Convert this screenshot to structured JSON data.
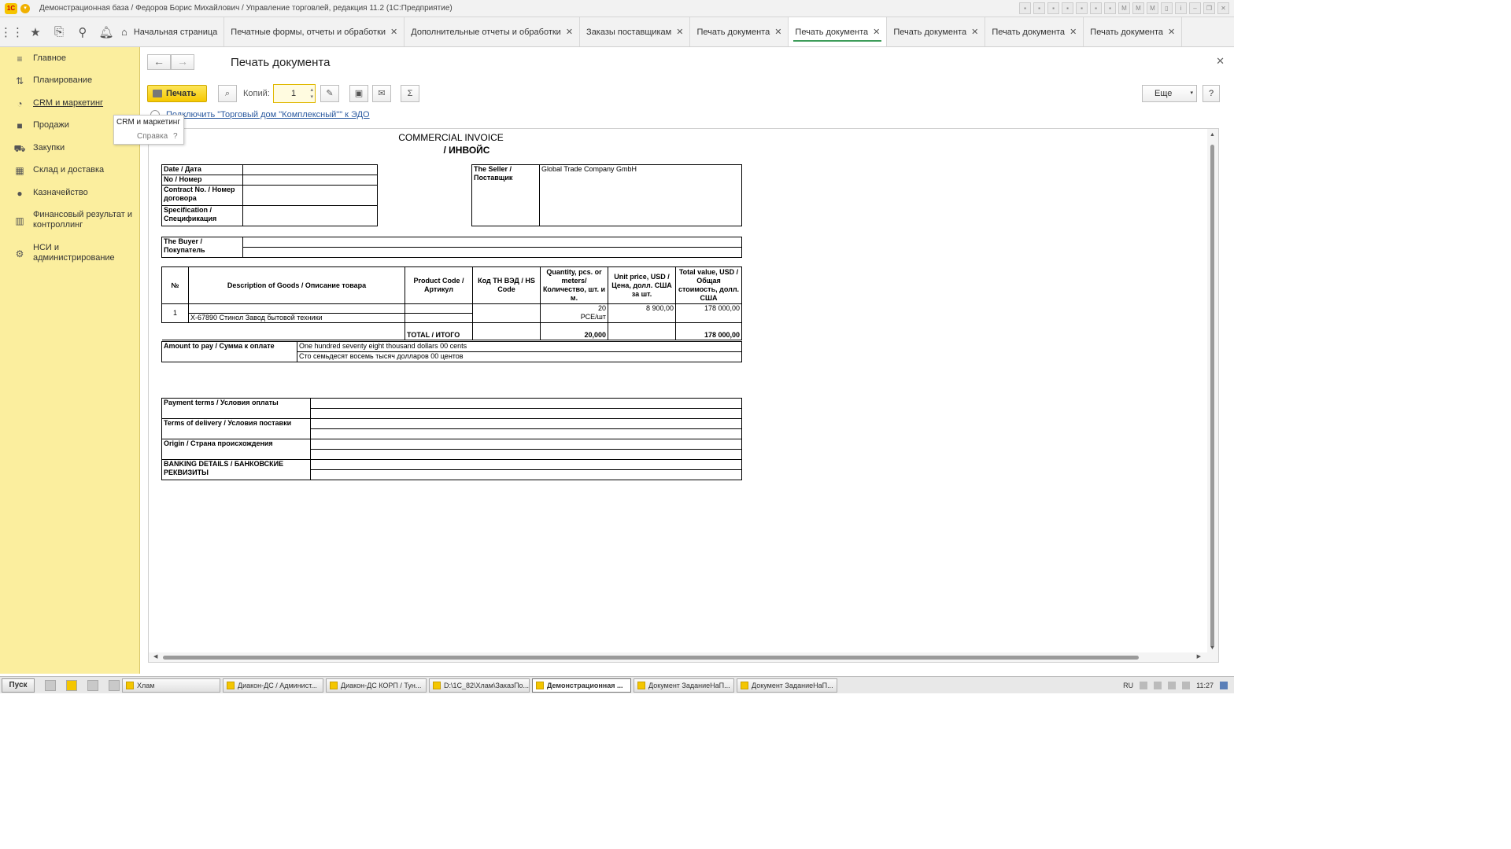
{
  "window": {
    "title": "Демонстрационная база / Федоров Борис Михайлович / Управление торговлей, редакция 11.2  (1С:Предприятие)"
  },
  "tabs": [
    {
      "label": "Начальная страница",
      "closable": false,
      "active": false
    },
    {
      "label": "Печатные формы, отчеты и обработки",
      "closable": true,
      "active": false
    },
    {
      "label": "Дополнительные отчеты и обработки",
      "closable": true,
      "active": false
    },
    {
      "label": "Заказы поставщикам",
      "closable": true,
      "active": false
    },
    {
      "label": "Печать документа",
      "closable": true,
      "active": false
    },
    {
      "label": "Печать документа",
      "closable": true,
      "active": true
    },
    {
      "label": "Печать документа",
      "closable": true,
      "active": false
    },
    {
      "label": "Печать документа",
      "closable": true,
      "active": false
    },
    {
      "label": "Печать документа",
      "closable": true,
      "active": false
    }
  ],
  "sidebar": {
    "items": [
      {
        "label": "Главное",
        "icon": "menu-icon"
      },
      {
        "label": "Планирование",
        "icon": "planning-icon"
      },
      {
        "label": "CRM и маркетинг",
        "icon": "crm-icon"
      },
      {
        "label": "Продажи",
        "icon": "sales-icon"
      },
      {
        "label": "Закупки",
        "icon": "cart-icon"
      },
      {
        "label": "Склад и доставка",
        "icon": "warehouse-icon"
      },
      {
        "label": "Казначейство",
        "icon": "treasury-icon"
      },
      {
        "label": "Финансовый результат и контроллинг",
        "icon": "chart-icon"
      },
      {
        "label": "НСИ и администрирование",
        "icon": "gear-icon"
      }
    ]
  },
  "tooltip": {
    "title": "CRM и маркетинг",
    "help": "Справка",
    "help_mark": "?"
  },
  "form": {
    "title": "Печать документа",
    "print_label": "Печать",
    "copies_label": "Копий:",
    "copies_value": "1",
    "more_label": "Еще",
    "help_label": "?",
    "edo_link": "Подключить \"Торговый дом \"Комплексный\"\" к ЭДО"
  },
  "invoice": {
    "heading_line1": "COMMERCIAL INVOICE",
    "heading_line2": "/ ИНВОЙС",
    "date_label": "Date / Дата",
    "no_label": "No / Номер",
    "contract_label": "Contract No. / Номер договора",
    "spec_label": "Specification / Спецификация",
    "seller_label": "The Seller / Поставщик",
    "seller_value": "Global Trade Company GmbH",
    "buyer_label": "The Buyer / Покупатель",
    "headers": {
      "num": "№",
      "desc": "Description of Goods / Описание товара",
      "code": "Product Code / Артикул",
      "hs": "Код ТН ВЭД / HS Code",
      "qty": "Quantity,  pcs. or meters/ Количество, шт. и м.",
      "price": "Unit price, USD / Цена, долл. США за шт.",
      "total": "Total value, USD / Общая стоимость, долл. США"
    },
    "rows": [
      {
        "num": "1",
        "desc": "X-67890 Стинол Завод бытовой техники",
        "qty": "20",
        "unit": "РСЕ/шт",
        "price": "8 900,00",
        "total": "178 000,00"
      }
    ],
    "total_label": "TOTAL / ИТОГО",
    "total_qty": "20,000",
    "total_sum": "178 000,00",
    "amount_label": "Amount to pay / Сумма к оплате",
    "amount_en": "One hundred seventy eight thousand dollars 00 cents",
    "amount_ru": "Сто семьдесят восемь тысяч долларов 00 центов",
    "payment_terms": "Payment terms / Условия оплаты",
    "delivery_terms": "Terms of delivery / Условия поставки",
    "origin": "Origin / Страна происхождения",
    "banking": "BANKING DETAILS / БАНКОВСКИЕ РЕКВИЗИТЫ"
  },
  "taskbar": {
    "start": "Пуск",
    "tasks": [
      {
        "label": "Хлам",
        "active": false
      },
      {
        "label": "Диакон-ДС / Админист...",
        "active": false
      },
      {
        "label": "Диакон-ДС КОРП / Тун...",
        "active": false
      },
      {
        "label": "D:\\1C_82\\Хлам\\ЗаказПо...",
        "active": false
      },
      {
        "label": "Демонстрационная ...",
        "active": true
      },
      {
        "label": "Документ ЗаданиеНаП...",
        "active": false
      },
      {
        "label": "Документ ЗаданиеНаП...",
        "active": false
      }
    ],
    "lang": "RU",
    "clock": "11:27"
  },
  "colors": {
    "sidebar": "#fbee9e",
    "accent": "#f6c800",
    "active_tab_line": "#3e9c5a",
    "link": "#2b5aa0"
  }
}
